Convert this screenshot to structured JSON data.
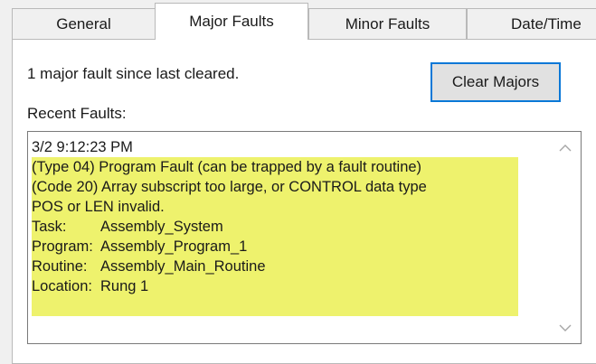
{
  "tabs": [
    {
      "label": "General"
    },
    {
      "label": "Major Faults"
    },
    {
      "label": "Minor Faults"
    },
    {
      "label": "Date/Time"
    }
  ],
  "summary": "1 major fault since last cleared.",
  "clear_button": "Clear Majors",
  "recent_label": "Recent Faults:",
  "fault": {
    "timestamp": "3/2  9:12:23 PM",
    "type_line": "(Type 04) Program Fault (can be trapped by a fault routine)",
    "code_line_1": "(Code 20) Array subscript too large, or CONTROL data type",
    "code_line_2": "POS or LEN invalid.",
    "details": [
      {
        "key": "Task:",
        "value": "Assembly_System"
      },
      {
        "key": "Program:",
        "value": "Assembly_Program_1"
      },
      {
        "key": "Routine:",
        "value": "Assembly_Main_Routine"
      },
      {
        "key": "Location:",
        "value": "Rung 1"
      }
    ]
  },
  "colors": {
    "highlight": "#eef26d",
    "button_border": "#0a78d7",
    "tab_border": "#b9b9b9"
  },
  "icons": {
    "scroll_up": "chevron-up-icon",
    "scroll_down": "chevron-down-icon"
  }
}
